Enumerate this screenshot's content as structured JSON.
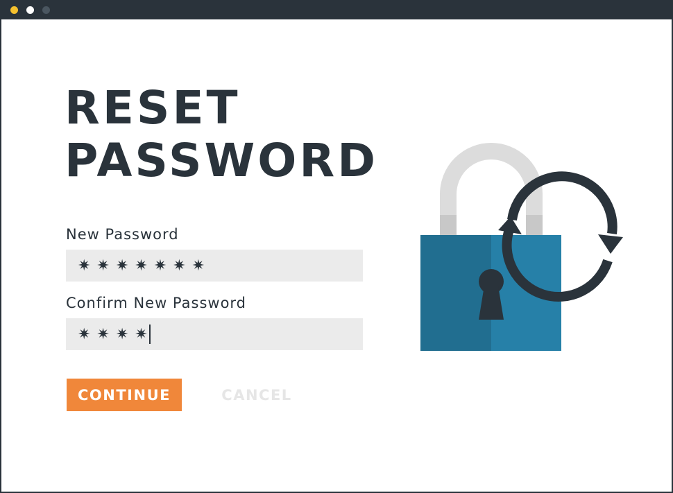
{
  "window": {
    "controls": [
      "close",
      "minimize",
      "maximize"
    ]
  },
  "page": {
    "title_line1": "RESET",
    "title_line2": "PASSWORD"
  },
  "form": {
    "new_password_label": "New Password",
    "new_password_value": "✷✷✷✷✷✷✷",
    "confirm_password_label": "Confirm New Password",
    "confirm_password_value": "✷✷✷✷"
  },
  "actions": {
    "continue_label": "CONTINUE",
    "cancel_label": "CANCEL"
  },
  "illustration": {
    "icon": "padlock-refresh-icon"
  },
  "colors": {
    "titlebar": "#2a333b",
    "dot_close": "#f5c12e",
    "dot_min": "#ffffff",
    "dot_max": "#4a5660",
    "accent": "#f0873a",
    "cancel_text": "#e6e6e6",
    "lock_body_dark": "#216e90",
    "lock_body_light": "#2680a8",
    "shackle": "#dcdcdc",
    "shackle_shadow": "#c8c8c8",
    "ink": "#2a333b"
  }
}
